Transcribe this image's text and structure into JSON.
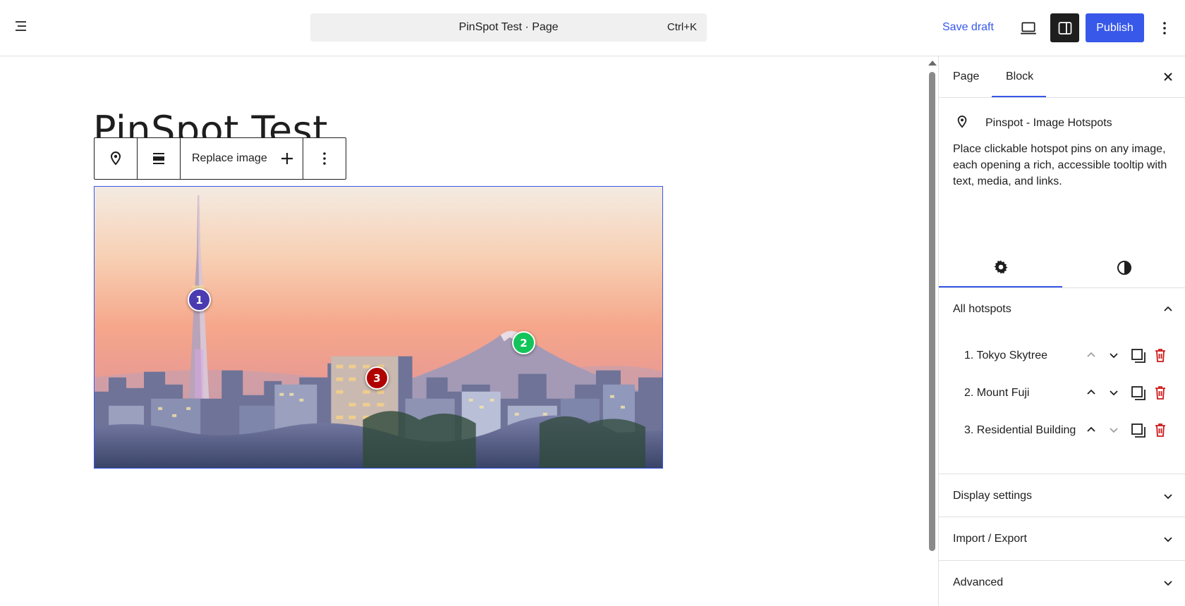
{
  "header": {
    "command_title": "PinSpot Test · Page",
    "command_shortcut": "Ctrl+K",
    "save_draft": "Save draft",
    "publish": "Publish",
    "icons": [
      "document-overview-icon",
      "desktop-preview-icon",
      "sidebar-toggle-icon",
      "more-vertical-icon"
    ]
  },
  "editor": {
    "page_title": "PinSpot Test",
    "toolbar": {
      "replace_image": "Replace image",
      "icons": [
        "map-pin-icon",
        "align-icon",
        "plus-icon",
        "more-vertical-icon"
      ]
    },
    "image": {
      "subject": "Tokyo skyline at sunset with Tokyo Skytree and Mount Fuji"
    },
    "pins": [
      {
        "number": "1",
        "color": "#4b3bb1"
      },
      {
        "number": "2",
        "color": "#13c45a"
      },
      {
        "number": "3",
        "color": "#b00000"
      }
    ]
  },
  "sidebar": {
    "tabs": {
      "page": "Page",
      "block": "Block",
      "active": "Block"
    },
    "block_card": {
      "title": "Pinspot - Image Hotspots",
      "description": "Place clickable hotspot pins on any image, each opening a rich, accessible tooltip with text, media, and links."
    },
    "inspector_tabs": [
      "settings-icon",
      "styles-icon"
    ],
    "panels": {
      "all_hotspots": {
        "title": "All hotspots",
        "expanded": true,
        "items": [
          {
            "label": "1. Tokyo Skytree",
            "can_move_up": false,
            "can_move_down": true
          },
          {
            "label": "2. Mount Fuji",
            "can_move_up": true,
            "can_move_down": true
          },
          {
            "label": "3. Residential Building",
            "can_move_up": true,
            "can_move_down": false
          }
        ]
      },
      "display_settings": {
        "title": "Display settings",
        "expanded": false
      },
      "import_export": {
        "title": "Import / Export",
        "expanded": false
      },
      "advanced": {
        "title": "Advanced",
        "expanded": false
      }
    }
  },
  "colors": {
    "accent": "#3858e9",
    "delete": "#cc1818",
    "text": "#1e1e1e",
    "disabled": "#a0a0a0"
  }
}
